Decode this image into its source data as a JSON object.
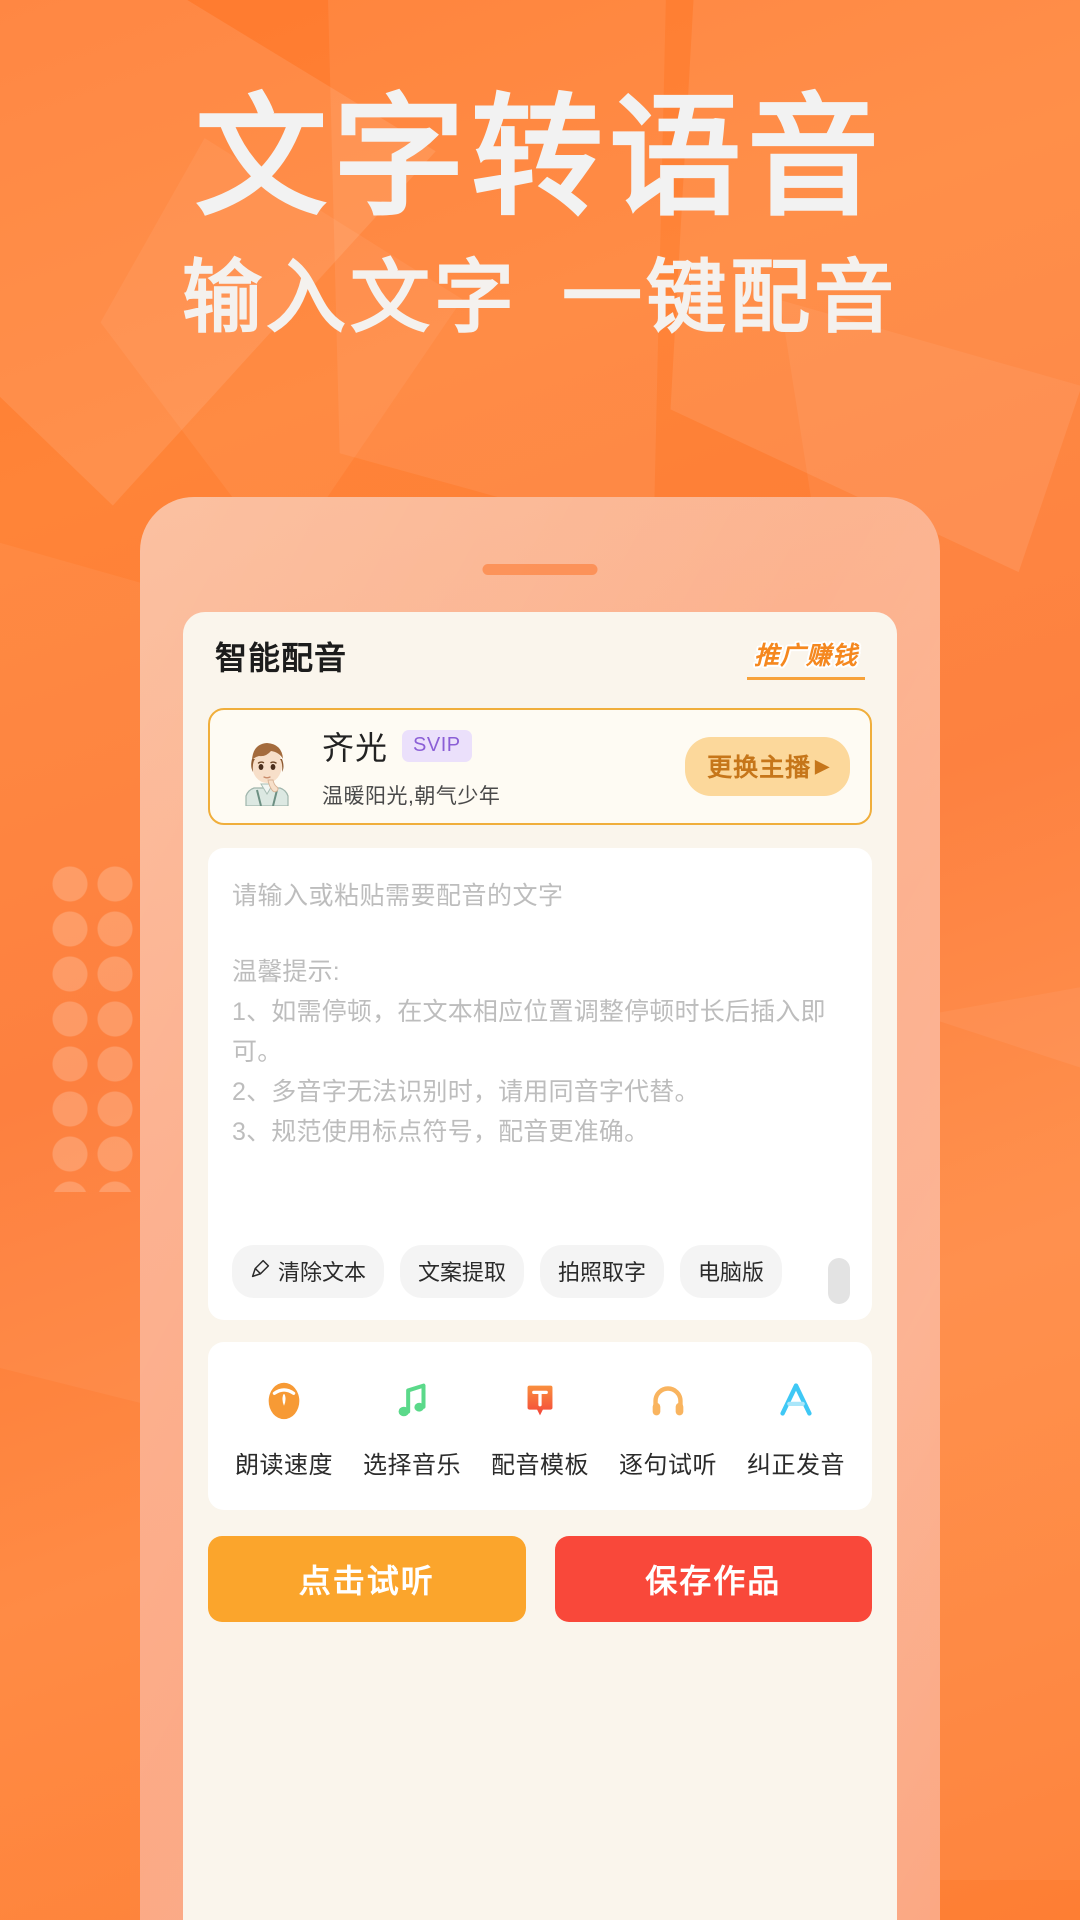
{
  "hero": {
    "title": "文字转语音",
    "subtitle_left": "输入文字",
    "subtitle_right": "一键配音"
  },
  "app": {
    "title": "智能配音",
    "promo_badge": "推广赚钱"
  },
  "speaker_card": {
    "name": "齐光",
    "vip_tag": "SVIP",
    "description": "温暖阳光,朝气少年",
    "change_button": "更换主播",
    "change_button_arrow": "▶",
    "avatar_icon": "anime-male-avatar"
  },
  "editor": {
    "placeholder": "请输入或粘贴需要配音的文字",
    "tips_title": "温馨提示:",
    "tips": [
      "1、如需停顿，在文本相应位置调整停顿时长后插入即可。",
      "2、多音字无法识别时，请用同音字代替。",
      "3、规范使用标点符号，配音更准确。"
    ],
    "chips": [
      {
        "label": "清除文本",
        "icon": "brush-icon"
      },
      {
        "label": "文案提取",
        "icon": ""
      },
      {
        "label": "拍照取字",
        "icon": ""
      },
      {
        "label": "电脑版",
        "icon": ""
      }
    ]
  },
  "tools": [
    {
      "label": "朗读速度",
      "icon": "speedometer-icon",
      "color": "#F79A35"
    },
    {
      "label": "选择音乐",
      "icon": "music-note-icon",
      "color": "#5BD98A"
    },
    {
      "label": "配音模板",
      "icon": "text-template-icon",
      "color": "#F4573C"
    },
    {
      "label": "逐句试听",
      "icon": "headphones-icon",
      "color": "#F9B45F"
    },
    {
      "label": "纠正发音",
      "icon": "letter-a-icon",
      "color": "#3FC8F5"
    }
  ],
  "footer": {
    "listen_button": "点击试听",
    "save_button": "保存作品"
  },
  "colors": {
    "background_orange": "#FF7F33",
    "phone_frame": "#FBAD88",
    "screen_bg": "#FAF5EC",
    "accent_yellow": "#F0AE3B",
    "listen_orange": "#FBA52C",
    "save_red": "#F9483A",
    "svip_purple": "#8B5FD6"
  }
}
